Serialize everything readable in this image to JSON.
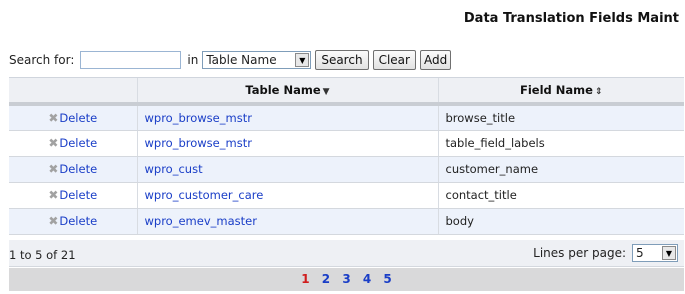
{
  "page": {
    "title": "Data Translation Fields Maint"
  },
  "search": {
    "label": "Search for:",
    "value": "",
    "in_label": "in",
    "field_select": "Table Name",
    "buttons": {
      "search": "Search",
      "clear": "Clear",
      "add": "Add"
    }
  },
  "grid": {
    "columns": {
      "table_name": "Table Name",
      "field_name": "Field Name"
    },
    "rows": [
      {
        "action": "Delete",
        "table_name": "wpro_browse_mstr",
        "field_name": "browse_title"
      },
      {
        "action": "Delete",
        "table_name": "wpro_browse_mstr",
        "field_name": "table_field_labels"
      },
      {
        "action": "Delete",
        "table_name": "wpro_cust",
        "field_name": "customer_name"
      },
      {
        "action": "Delete",
        "table_name": "wpro_customer_care",
        "field_name": "contact_title"
      },
      {
        "action": "Delete",
        "table_name": "wpro_emev_master",
        "field_name": "body"
      }
    ]
  },
  "footer": {
    "range_text": "1 to 5 of 21",
    "lines_per_page_label": "Lines per page:",
    "lines_per_page_value": "5"
  },
  "pager": {
    "pages": [
      "1",
      "2",
      "3",
      "4",
      "5"
    ],
    "current": "1"
  }
}
